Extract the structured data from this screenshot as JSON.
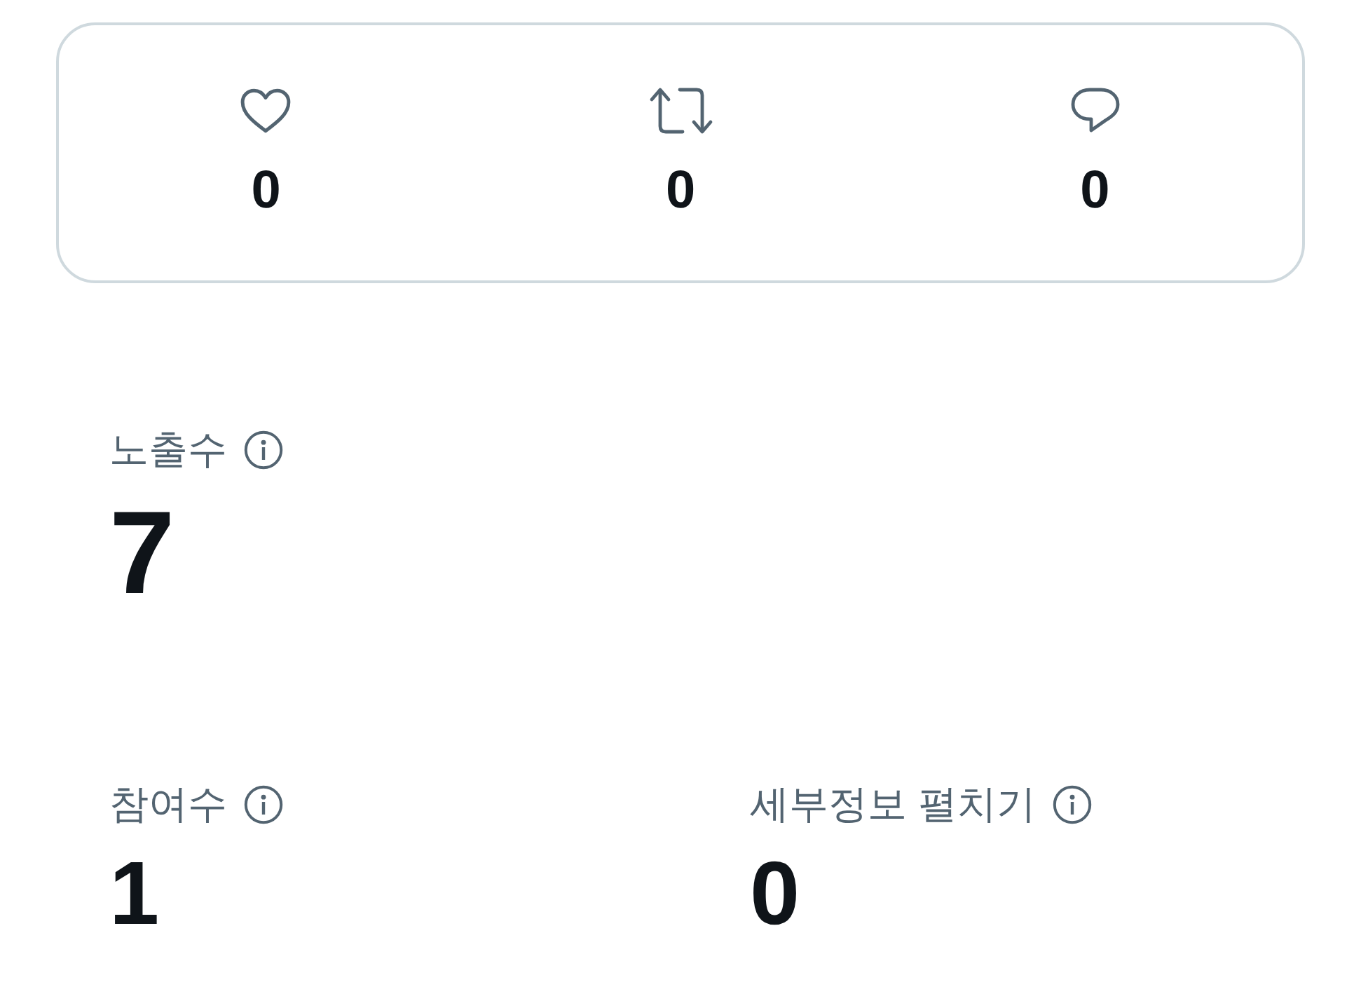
{
  "engagement_card": {
    "items": [
      {
        "kind": "likes",
        "count": "0"
      },
      {
        "kind": "reposts",
        "count": "0"
      },
      {
        "kind": "replies",
        "count": "0"
      }
    ]
  },
  "metric_rows": [
    {
      "metrics": [
        {
          "label": "노출수",
          "value": "7"
        }
      ]
    },
    {
      "metrics": [
        {
          "label": "참여수",
          "value": "1"
        },
        {
          "label": "세부정보 펼치기",
          "value": "0"
        }
      ]
    }
  ]
}
